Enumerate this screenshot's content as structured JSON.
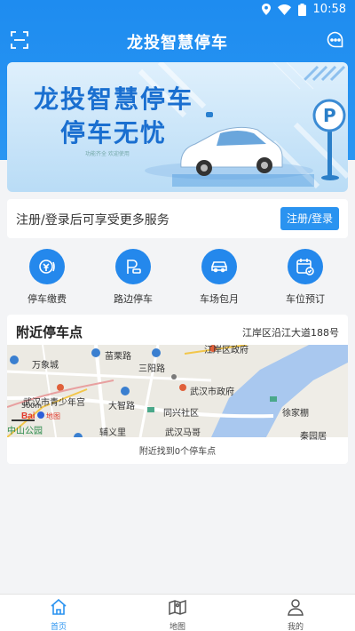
{
  "status_bar": {
    "time": "10:58"
  },
  "header": {
    "title": "龙投智慧停车"
  },
  "banner": {
    "line1": "龙投智慧停车",
    "line2": "停车无忧",
    "sub": "功能齐全 欢迎使用"
  },
  "login": {
    "prompt": "注册/登录后可享受更多服务",
    "button": "注册/登录"
  },
  "services": [
    {
      "label": "停车缴费",
      "icon": "yuan-coin-icon"
    },
    {
      "label": "路边停车",
      "icon": "roadside-parking-icon"
    },
    {
      "label": "车场包月",
      "icon": "car-icon"
    },
    {
      "label": "车位预订",
      "icon": "calendar-check-icon"
    }
  ],
  "nearby": {
    "title": "附近停车点",
    "address": "江岸区沿江大道188号",
    "result": "附近找到0个停车点",
    "map_labels": [
      "苗栗路",
      "万象城",
      "三阳路",
      "江岸区政府",
      "武汉市政府",
      "武汉市青少年宫",
      "大智路",
      "同兴社区",
      "徐家棚",
      "中山公园",
      "辅义里",
      "武汉马哥",
      "秦园居",
      "500m"
    ]
  },
  "bottom_nav": [
    {
      "label": "首页",
      "active": true
    },
    {
      "label": "地图",
      "active": false
    },
    {
      "label": "我的",
      "active": false
    }
  ],
  "colors": {
    "primary": "#2a93f0",
    "header": "#1e8cf0"
  }
}
